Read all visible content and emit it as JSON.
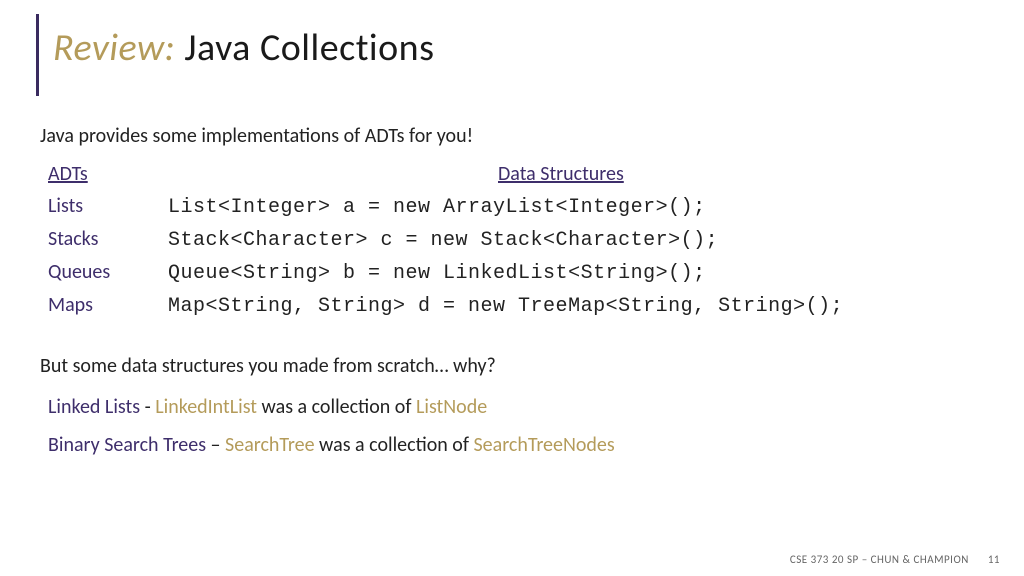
{
  "title": {
    "prefix": "Review:",
    "main": " Java Collections"
  },
  "intro": "Java provides some implementations of ADTs for you!",
  "headers": {
    "adts": "ADTs",
    "ds": "Data Structures"
  },
  "rows": [
    {
      "adt": "Lists",
      "code": "List<Integer> a = new ArrayList<Integer>();"
    },
    {
      "adt": "Stacks",
      "code": "Stack<Character> c = new Stack<Character>();"
    },
    {
      "adt": "Queues",
      "code": "Queue<String> b = new LinkedList<String>();"
    },
    {
      "adt": "Maps",
      "code": "Map<String, String> d = new TreeMap<String, String>();"
    }
  ],
  "why": "But some data structures you made from scratch… why?",
  "scratch": [
    {
      "ds": "Linked Lists",
      "sep": " - ",
      "gold1": "LinkedIntList",
      "mid": " was a collection of ",
      "gold2": "ListNode"
    },
    {
      "ds": "Binary Search Trees",
      "sep": " – ",
      "gold1": "SearchTree",
      "mid": " was a collection of ",
      "gold2": "SearchTreeNodes"
    }
  ],
  "footer": {
    "course": "CSE 373 20 SP – CHUN & CHAMPION",
    "page": "11"
  }
}
